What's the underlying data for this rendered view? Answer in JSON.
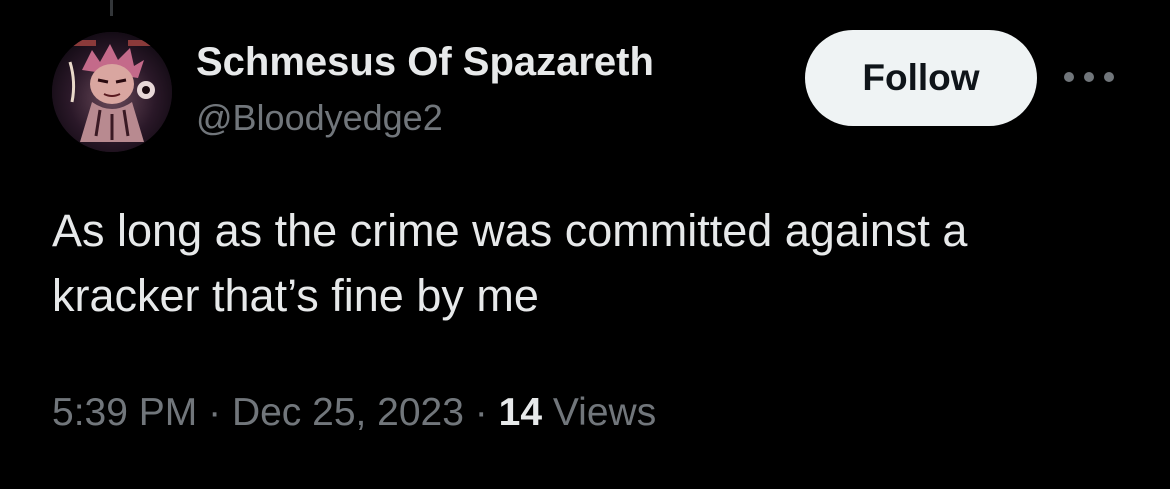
{
  "tweet": {
    "author": {
      "display_name": "Schmesus Of Spazareth",
      "handle": "@Bloodyedge2",
      "avatar_icon": "anime-character-avatar"
    },
    "follow_label": "Follow",
    "more_icon": "more-horizontal-icon",
    "text_lines": [
      "As long as the crime was committed against a",
      "kracker that’s fine by me"
    ],
    "meta": {
      "time": "5:39 PM",
      "separator": "·",
      "date": "Dec 25, 2023",
      "views_count": "14",
      "views_label": "Views"
    }
  },
  "colors": {
    "background": "#000000",
    "primary_text": "#e7e9ea",
    "secondary_text": "#71767b",
    "follow_bg": "#eff3f4",
    "follow_text": "#0f1419"
  }
}
